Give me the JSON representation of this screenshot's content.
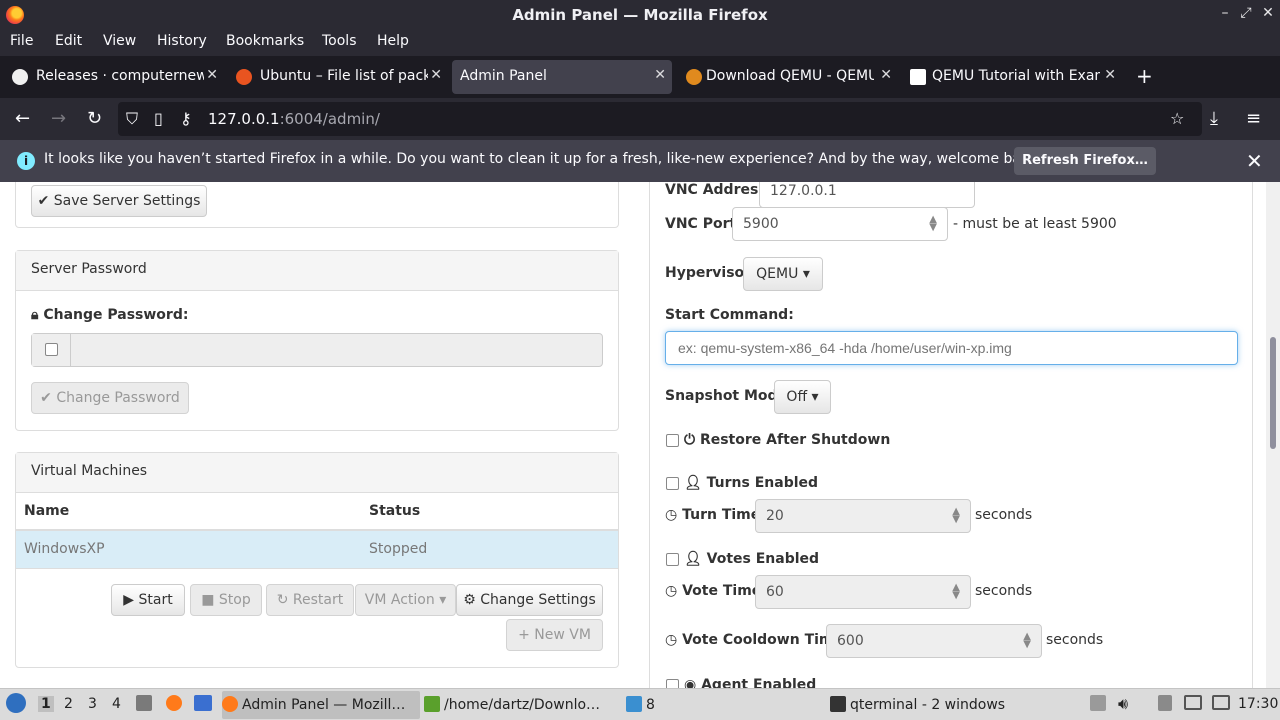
{
  "window": {
    "title": "Admin Panel — Mozilla Firefox",
    "controls": [
      "–",
      "⤢",
      "✕"
    ]
  },
  "menubar": [
    "File",
    "Edit",
    "View",
    "History",
    "Bookmarks",
    "Tools",
    "Help"
  ],
  "tabs": [
    {
      "label": "Releases · computernewb",
      "icon": "github-icon",
      "active": false
    },
    {
      "label": "Ubuntu – File list of pack",
      "icon": "ubuntu-icon",
      "active": false
    },
    {
      "label": "Admin Panel",
      "icon": "",
      "active": true
    },
    {
      "label": "Download QEMU - QEMU",
      "icon": "qemu-icon",
      "active": false
    },
    {
      "label": "QEMU Tutorial with Exam",
      "icon": "page-icon",
      "active": false
    }
  ],
  "newtab": "+",
  "address": {
    "host": "127.0.0.1",
    "path": ":6004/admin/"
  },
  "notification": {
    "message": "It looks like you haven’t started Firefox in a while. Do you want to clean it up for a fresh, like-new experience? And by the way, welcome back!",
    "button": "Refresh Firefox…"
  },
  "left": {
    "save_server_settings": "Save Server Settings",
    "server_password": {
      "heading": "Server Password",
      "change_label": "Change Password:",
      "button": "Change Password"
    },
    "virtual_machines": {
      "heading": "Virtual Machines",
      "columns": [
        "Name",
        "Status"
      ],
      "rows": [
        {
          "name": "WindowsXP",
          "status": "Stopped"
        }
      ],
      "buttons": {
        "start": "Start",
        "stop": "Stop",
        "restart": "Restart",
        "vm_action": "VM Action",
        "change_settings": "Change Settings",
        "new_vm": "New VM"
      }
    }
  },
  "right": {
    "vnc_address": {
      "label": "VNC Address:",
      "value": "127.0.0.1"
    },
    "vnc_port": {
      "label": "VNC Port:",
      "value": "5900",
      "hint": "- must be at least 5900"
    },
    "hypervisor": {
      "label": "Hypervisor:",
      "value": "QEMU"
    },
    "start_command": {
      "label": "Start Command:",
      "placeholder": "ex: qemu-system-x86_64 -hda /home/user/win-xp.img"
    },
    "snapshot_mode": {
      "label": "Snapshot Mode:",
      "value": "Off"
    },
    "restore_after_shutdown": "Restore After Shutdown",
    "turns_enabled": "Turns Enabled",
    "turn_time": {
      "label": "Turn Time:",
      "value": "20",
      "unit": "seconds"
    },
    "votes_enabled": "Votes Enabled",
    "vote_time": {
      "label": "Vote Time:",
      "value": "60",
      "unit": "seconds"
    },
    "vote_cooldown": {
      "label": "Vote Cooldown Time:",
      "value": "600",
      "unit": "seconds"
    },
    "agent_enabled": "Agent Enabled"
  },
  "taskbar": {
    "workspaces": [
      "1",
      "2",
      "3",
      "4"
    ],
    "items": [
      {
        "label": "Admin Panel — Mozill…",
        "active": true
      },
      {
        "label": "/home/dartz/Downlo…",
        "active": false
      },
      {
        "label": "8",
        "active": false
      },
      {
        "label": "qterminal - 2 windows",
        "active": false
      }
    ],
    "clock": "17:30"
  }
}
